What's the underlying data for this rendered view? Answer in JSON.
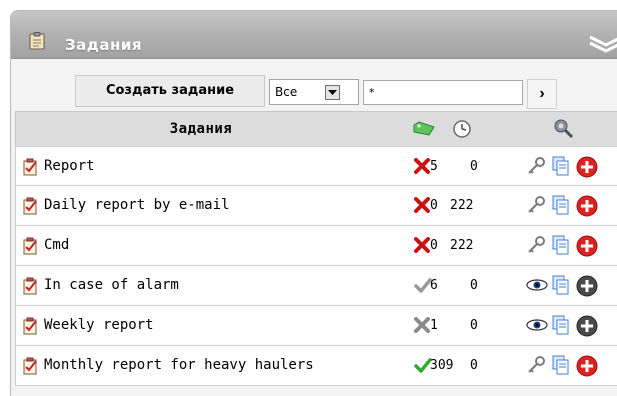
{
  "panel": {
    "title": "Задания",
    "title_icon": "clipboard-icon",
    "collapse_icon": "double-chevron-up-icon"
  },
  "toolbar": {
    "create_label": "Создать задание",
    "filter_select_value": "Все",
    "filter_input_value": "*",
    "go_label": "›"
  },
  "table": {
    "header_name": "Задания",
    "header_icons": [
      "status-tag-icon",
      "clock-icon",
      "tools-icon"
    ],
    "rows": [
      {
        "name": "Report",
        "status": "error",
        "count": "5",
        "secs": "0",
        "view": "key",
        "delete_active": true
      },
      {
        "name": "Daily report by e-mail",
        "status": "error",
        "count": "0",
        "secs": "222",
        "view": "key",
        "delete_active": true
      },
      {
        "name": "Cmd",
        "status": "error",
        "count": "0",
        "secs": "222",
        "view": "key",
        "delete_active": true
      },
      {
        "name": "In case of alarm",
        "status": "ok-gray",
        "count": "6",
        "secs": "0",
        "view": "eye",
        "delete_active": false
      },
      {
        "name": "Weekly report",
        "status": "error-gray",
        "count": "1",
        "secs": "0",
        "view": "eye",
        "delete_active": false
      },
      {
        "name": "Monthly report for heavy haulers",
        "status": "ok",
        "count": "309",
        "secs": "0",
        "view": "key",
        "delete_active": true
      }
    ]
  },
  "colors": {
    "title_bar": "#b3b3b3",
    "header_bg": "#dcdcdc",
    "error_red": "#cc1111",
    "ok_green": "#33aa33",
    "delete_red": "#dd2222",
    "copy_blue": "#3f7fd8"
  }
}
